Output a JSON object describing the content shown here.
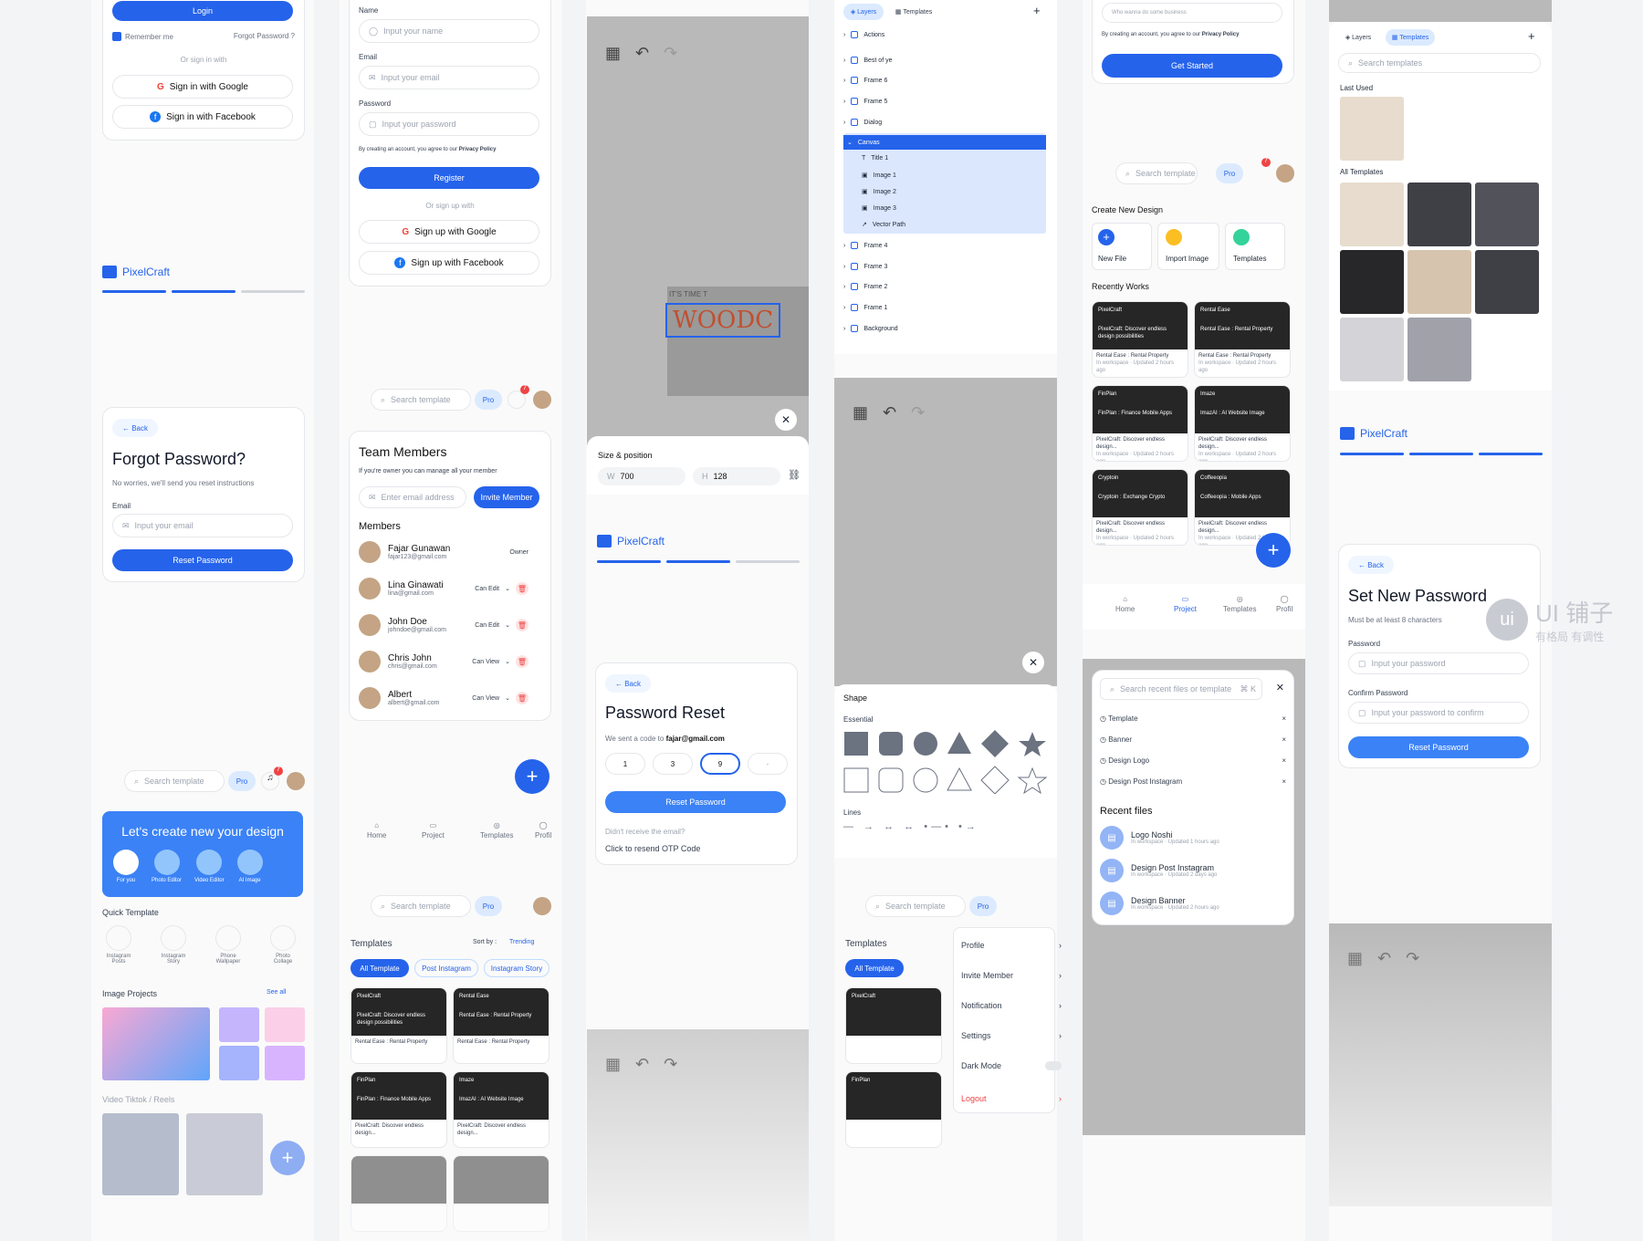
{
  "login": {
    "login_btn": "Login",
    "remember": "Remember me",
    "forgot": "Forgot Password ?",
    "or_signin": "Or sign in with",
    "google": "Sign in with Google",
    "facebook": "Sign in with Facebook"
  },
  "brand": {
    "name": "PixelCraft"
  },
  "forgot": {
    "back": "Back",
    "title": "Forgot Password?",
    "subtitle": "No worries, we'll send you reset instructions",
    "email_label": "Email",
    "email_ph": "Input your email",
    "reset_btn": "Reset Password"
  },
  "home": {
    "search_ph": "Search template",
    "pro": "Pro",
    "notif_count": "7",
    "banner": "Let's create new your design",
    "tools": [
      "For you",
      "Photo Editor",
      "Video Editor",
      "AI Image"
    ],
    "quick_title": "Quick Template",
    "quick": [
      "Instagram Posts",
      "Instagram Story",
      "Phone Wallpaper",
      "Photo Collage"
    ],
    "image_projects": "Image Projects",
    "see_all": "See all",
    "video": "Video Tiktok / Reels"
  },
  "register": {
    "name_label": "Name",
    "name_ph": "Input your name",
    "email_label": "Email",
    "email_ph": "Input your email",
    "pw_label": "Password",
    "pw_ph": "Input your password",
    "agree": "By creating an account, you agree to our",
    "privacy": "Privacy Policy",
    "register_btn": "Register",
    "or_signup": "Or sign up with",
    "google": "Sign up with Google",
    "facebook": "Sign up with Facebook"
  },
  "team": {
    "title": "Team Members",
    "hint": "If you're owner you can manage all your member",
    "email_ph": "Enter email address",
    "invite": "Invite Member",
    "members_title": "Members",
    "members": [
      {
        "name": "Fajar Gunawan",
        "email": "fajar123@gmail.com",
        "role": "Owner"
      },
      {
        "name": "Lina Ginawati",
        "email": "lina@gmail.com",
        "role": "Can Edit"
      },
      {
        "name": "John Doe",
        "email": "johndoe@gmail.com",
        "role": "Can Edit"
      },
      {
        "name": "Chris John",
        "email": "chris@gmail.com",
        "role": "Can View"
      },
      {
        "name": "Albert",
        "email": "albert@gmail.com",
        "role": "Can View"
      }
    ]
  },
  "nav": {
    "home": "Home",
    "project": "Project",
    "templates": "Templates",
    "profile": "Profil"
  },
  "templates_page": {
    "title": "Templates",
    "sort": "Sort by :",
    "trending": "Trending",
    "filters": [
      "All Template",
      "Post Instagram",
      "Instagram Story"
    ]
  },
  "cards": [
    {
      "brand": "PixelCraft",
      "title": "PixelCraft: Discover endless design possibilities",
      "sub": "Rental Ease : Rental Property",
      "meta": "In workspace · Updated 2 hours ago"
    },
    {
      "brand": "Rental Ease",
      "title": "Rental Ease : Rental Property",
      "sub": "Rental Ease : Rental Property",
      "meta": "In workspace · Updated 2 hours ago"
    },
    {
      "brand": "FinPlan",
      "title": "FinPlan : Finance Mobile Apps",
      "sub": "PixelCraft: Discover endless design...",
      "meta": "In workspace · Updated 2 hours ago"
    },
    {
      "brand": "Imaze",
      "title": "ImazAI : AI Website Image",
      "sub": "PixelCraft: Discover endless design...",
      "meta": "In workspace · Updated 2 hours ago"
    },
    {
      "brand": "Cryptoin",
      "title": "Cryptoin : Exchange Crypto",
      "sub": "PixelCraft: Discover endless design...",
      "meta": "In workspace · Updated 2 hours ago"
    },
    {
      "brand": "Coffeeopia",
      "title": "Coffeeopia : Mobile Apps",
      "sub": "PixelCraft: Discover endless design...",
      "meta": "In workspace · Updated 2 hours ago"
    }
  ],
  "editor": {
    "size_title": "Size & position",
    "w_label": "W",
    "w": "700",
    "h_label": "H",
    "h": "128",
    "woodc": "WOODC",
    "its_time": "IT'S TIME T"
  },
  "reset": {
    "back": "Back",
    "title": "Password Reset",
    "sent": "We sent a code to",
    "email": "fajar@gmail.com",
    "otp": [
      "1",
      "3",
      "9",
      "-"
    ],
    "btn": "Reset Password",
    "didnt": "Didn't receive the email?",
    "resend": "Click to resend OTP Code"
  },
  "layers": {
    "tab_layers": "Layers",
    "tab_templates": "Templates",
    "items": [
      "Actions",
      "Best of ye",
      "Frame 6",
      "Frame 5",
      "Dialog",
      "Canvas",
      "Title 1",
      "Image 1",
      "Image 2",
      "Image 3",
      "Vector Path",
      "Frame 4",
      "Frame 3",
      "Frame 2",
      "Frame 1",
      "Background"
    ]
  },
  "shape": {
    "title": "Shape",
    "essential": "Essential",
    "lines": "Lines"
  },
  "profile_menu": {
    "items": [
      "Profile",
      "Invite Member",
      "Notification",
      "Settings",
      "Dark Mode",
      "Logout"
    ]
  },
  "signup": {
    "placeholder": "Who wanna do some business",
    "agree": "By creating an account, you agree to our",
    "privacy": "Privacy Policy",
    "btn": "Get Started"
  },
  "dashboard": {
    "search_ph": "Search template",
    "create": "Create New Design",
    "new_file": "New File",
    "import": "Import Image",
    "templates": "Templates",
    "recent": "Recently Works"
  },
  "search": {
    "ph": "Search recent files or template",
    "kbd": "⌘ K",
    "history": [
      "Template",
      "Banner",
      "Design Logo",
      "Design Post Instagram"
    ],
    "recent_title": "Recent files",
    "recent": [
      {
        "name": "Logo Noshi",
        "meta": "In workspace · Updated 1 hours ago"
      },
      {
        "name": "Design Post Instagram",
        "meta": "In workspace · Updated 2 days ago"
      },
      {
        "name": "Design Banner",
        "meta": "In workspace · Updated 2 hours ago"
      }
    ]
  },
  "template_panel": {
    "tab_layers": "Layers",
    "tab_templates": "Templates",
    "search_ph": "Search templates",
    "last_used": "Last Used",
    "all": "All Templates"
  },
  "setpw": {
    "back": "Back",
    "title": "Set New Password",
    "sub": "Must be at least 8 characters",
    "pw_label": "Password",
    "pw_ph": "Input your password",
    "confirm_label": "Confirm Password",
    "confirm_ph": "Input your password to confirm",
    "btn": "Reset Password"
  },
  "watermark": {
    "text": "UI 铺子",
    "sub": "有格局 有调性"
  }
}
